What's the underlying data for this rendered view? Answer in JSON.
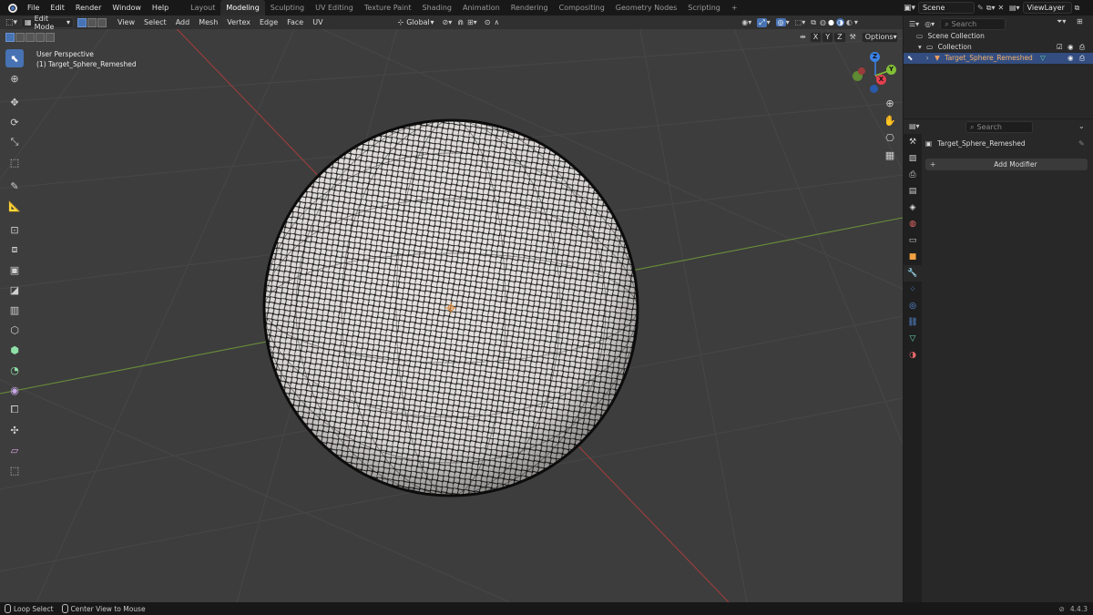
{
  "menu": [
    "File",
    "Edit",
    "Render",
    "Window",
    "Help"
  ],
  "workspaces": [
    "Layout",
    "Modeling",
    "Sculpting",
    "UV Editing",
    "Texture Paint",
    "Shading",
    "Animation",
    "Rendering",
    "Compositing",
    "Geometry Nodes",
    "Scripting"
  ],
  "active_workspace": "Modeling",
  "add_workspace": "+",
  "scene_name": "Scene",
  "view_layer": "ViewLayer",
  "viewport_header": {
    "mode": "Edit Mode",
    "menus": [
      "View",
      "Select",
      "Add",
      "Mesh",
      "Vertex",
      "Edge",
      "Face",
      "UV"
    ],
    "transform_orientation": "Global",
    "axes": [
      "X",
      "Y",
      "Z"
    ],
    "options": "Options"
  },
  "viewport_info": {
    "view_name": "User Perspective",
    "object_label": "(1) Target_Sphere_Remeshed"
  },
  "gizmo": {
    "x": "X",
    "y": "Y",
    "z": "Z"
  },
  "outliner": {
    "search_placeholder": "Search",
    "scene_collection": "Scene Collection",
    "collection": "Collection",
    "object": "Target_Sphere_Remeshed"
  },
  "properties": {
    "search_placeholder": "Search",
    "object_name": "Target_Sphere_Remeshed",
    "add_modifier": "Add Modifier"
  },
  "statusbar": {
    "loop_select": "Loop Select",
    "center_view": "Center View to Mouse",
    "version": "4.4.3"
  },
  "colors": {
    "accent": "#4772b3",
    "x_axis": "#e4404f",
    "y_axis": "#82bf36",
    "z_axis": "#3b82e6",
    "viewport_bg": "#3d3d3d"
  }
}
